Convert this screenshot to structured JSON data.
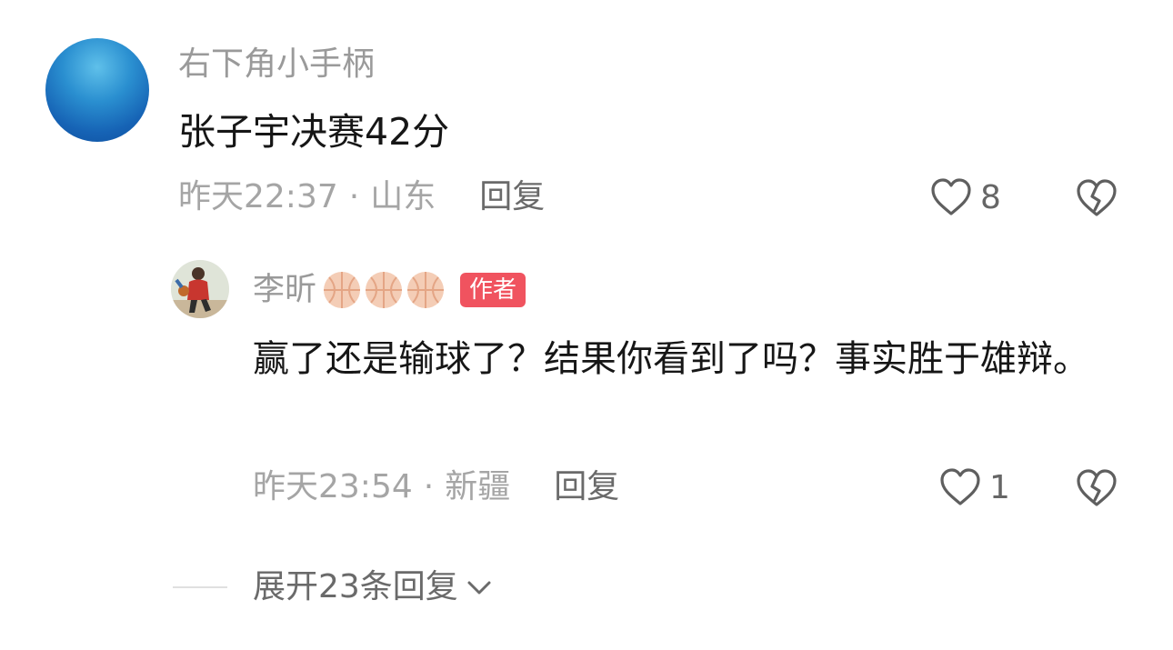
{
  "comment": {
    "username": "右下角小手柄",
    "content": "张子宇决赛42分",
    "time": "昨天22:37",
    "separator": "·",
    "location": "山东",
    "reply_label": "回复",
    "like_count": "8",
    "avatar_color": "#1f73c2"
  },
  "reply": {
    "username": "李昕",
    "badge": "作者",
    "badge_color": "#f0535f",
    "content": "赢了还是输球了？结果你看到了吗？事实胜于雄辩。",
    "time": "昨天23:54",
    "separator": "·",
    "location": "新疆",
    "reply_label": "回复",
    "like_count": "1",
    "decor_icons": [
      "basketball-icon",
      "basketball-icon",
      "basketball-icon"
    ]
  },
  "expand": {
    "label": "展开23条回复"
  },
  "icons": {
    "like": "heart-outline-icon",
    "dislike": "broken-heart-icon",
    "expand": "chevron-down-icon"
  }
}
